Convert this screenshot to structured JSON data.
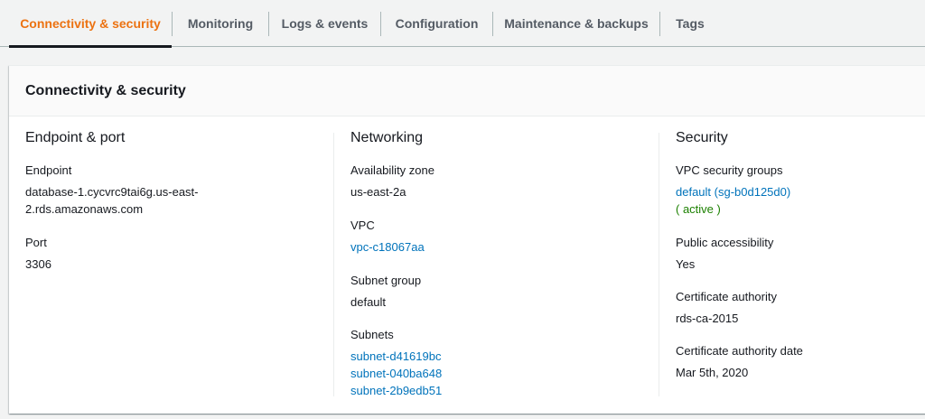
{
  "tabs": [
    {
      "label": "Connectivity & security",
      "active": true
    },
    {
      "label": "Monitoring"
    },
    {
      "label": "Logs & events"
    },
    {
      "label": "Configuration"
    },
    {
      "label": "Maintenance & backups"
    },
    {
      "label": "Tags"
    }
  ],
  "panel": {
    "title": "Connectivity & security"
  },
  "endpoint_port": {
    "title": "Endpoint & port",
    "endpoint_label": "Endpoint",
    "endpoint_line1": "database-1.cycvrc9tai6g.us-east-",
    "endpoint_line2": "2.rds.amazonaws.com",
    "port_label": "Port",
    "port_value": "3306"
  },
  "networking": {
    "title": "Networking",
    "az_label": "Availability zone",
    "az_value": "us-east-2a",
    "vpc_label": "VPC",
    "vpc_value": "vpc-c18067aa",
    "subnet_group_label": "Subnet group",
    "subnet_group_value": "default",
    "subnets_label": "Subnets",
    "subnets": [
      "subnet-d41619bc",
      "subnet-040ba648",
      "subnet-2b9edb51"
    ]
  },
  "security": {
    "title": "Security",
    "sg_label": "VPC security groups",
    "sg_value": "default (sg-b0d125d0)",
    "sg_status": "( active )",
    "public_label": "Public accessibility",
    "public_value": "Yes",
    "ca_label": "Certificate authority",
    "ca_value": "rds-ca-2015",
    "ca_date_label": "Certificate authority date",
    "ca_date_value": "Mar 5th, 2020"
  },
  "colors": {
    "active_tab": "#ec7211",
    "link": "#0073bb",
    "status_ok": "#1d8102"
  }
}
